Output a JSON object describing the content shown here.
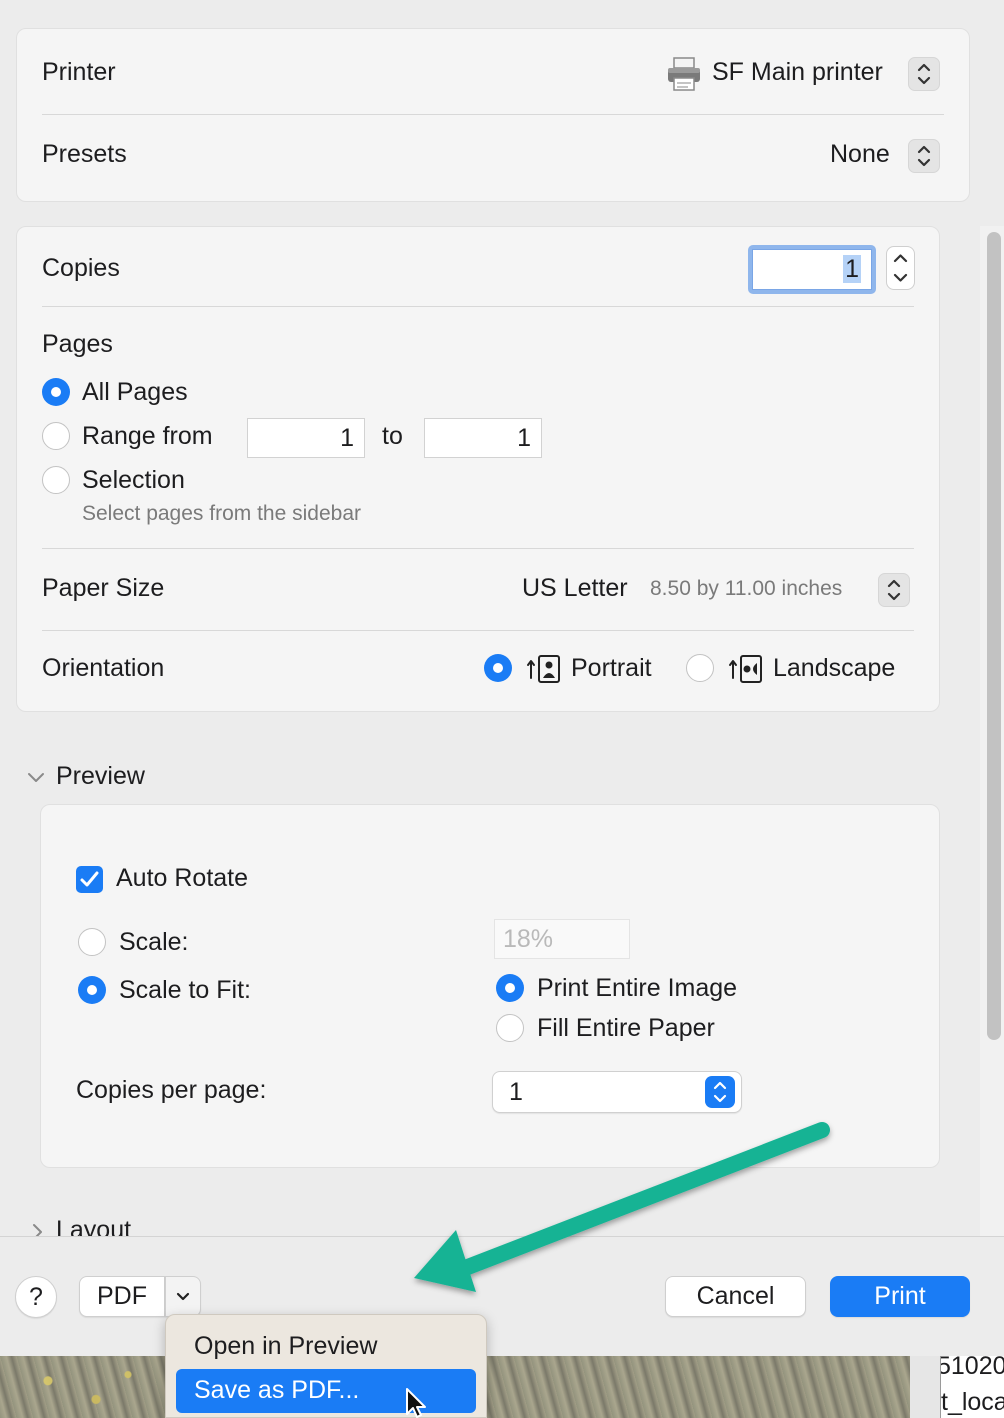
{
  "printer": {
    "label": "Printer",
    "value": "SF Main printer"
  },
  "presets": {
    "label": "Presets",
    "value": "None"
  },
  "copies": {
    "label": "Copies",
    "value": "1"
  },
  "pages": {
    "label": "Pages",
    "all_pages": "All Pages",
    "range_from": "Range from",
    "range_start": "1",
    "range_to": "to",
    "range_end": "1",
    "selection": "Selection",
    "selection_hint": "Select pages from the sidebar"
  },
  "paper_size": {
    "label": "Paper Size",
    "value": "US Letter",
    "detail": "8.50 by 11.00 inches"
  },
  "orientation": {
    "label": "Orientation",
    "portrait": "Portrait",
    "landscape": "Landscape"
  },
  "preview": {
    "title": "Preview",
    "auto_rotate": "Auto Rotate",
    "scale_label": "Scale:",
    "scale_value": "18%",
    "scale_to_fit": "Scale to Fit:",
    "print_entire_image": "Print Entire Image",
    "fill_entire_paper": "Fill Entire Paper",
    "copies_per_page_label": "Copies per page:",
    "copies_per_page_value": "1"
  },
  "layout": {
    "title": "Layout"
  },
  "footer": {
    "help": "?",
    "pdf": "PDF",
    "cancel": "Cancel",
    "print": "Print"
  },
  "pdf_menu": {
    "items": [
      "Open in Preview",
      "Save as PDF..."
    ]
  },
  "background_text": {
    "line1": "51020",
    "line2": "t_loca"
  },
  "colors": {
    "accent": "#1a7cf5",
    "annotation_arrow": "#17b394"
  }
}
